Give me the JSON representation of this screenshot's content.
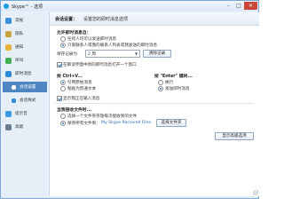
{
  "window": {
    "title": "Skype™ - 选项",
    "controls": {
      "minimize": "–",
      "maximize": "□",
      "close": "✕"
    }
  },
  "sidebar": {
    "items": [
      {
        "label": "常规",
        "icon": "general-icon",
        "color": "#3a8fd6"
      },
      {
        "label": "隐私",
        "icon": "privacy-icon",
        "color": "#c9a23a"
      },
      {
        "label": "通知",
        "icon": "notifications-icon",
        "color": "#e4b13a"
      },
      {
        "label": "呼叫",
        "icon": "calls-icon",
        "color": "#3fae55"
      },
      {
        "label": "即时消息",
        "icon": "im-icon",
        "color": "#2f8ad8"
      },
      {
        "label": "会话设置",
        "icon": "im-settings-icon",
        "color": "#2f8ad8",
        "active": true
      },
      {
        "label": "会话样式",
        "icon": "im-style-icon",
        "color": "#2f8ad8"
      },
      {
        "label": "提示音",
        "icon": "sounds-icon",
        "color": "#3a9be0"
      },
      {
        "label": "高级",
        "icon": "advanced-icon",
        "color": "#6a7c8e"
      }
    ]
  },
  "header": {
    "title": "会话设置：",
    "subtitle": "设置您的即时消息选项"
  },
  "sections": {
    "allow": {
      "title": "允许即时消息自：",
      "options": [
        "任何人均可以发送即时消息",
        "只限联系人或我的联系人列表或我发送的即时消息"
      ],
      "selected": 1
    },
    "history": {
      "label": "保存记录为",
      "value": "2 周",
      "clear_button": "清除记录"
    },
    "open_new_window": {
      "label": "在聊谈界面中新的即时消息打开一个窗口",
      "checked": true
    },
    "ctrl_v": {
      "title": "按 Ctrl+V...",
      "options": [
        "引用原始消息",
        "粘贴为普通文本"
      ],
      "selected": 0
    },
    "enter": {
      "title": "按 \"Enter\" 键将...",
      "options": [
        "换行",
        "发送即时消息"
      ],
      "selected": 1
    },
    "show_typing": {
      "label": "显示我正在输入消息",
      "checked": true
    },
    "file_receive": {
      "title": "当我接收文件时...",
      "options": [
        {
          "text": "选择一个文件夹存放每次接收到的文件",
          "link": ""
        },
        {
          "text": "保存所有文件到：",
          "link": "My Skype Received Files"
        }
      ],
      "selected": 1,
      "choose_button": "选择文件夹"
    },
    "advanced_button": "显示高级选项"
  }
}
